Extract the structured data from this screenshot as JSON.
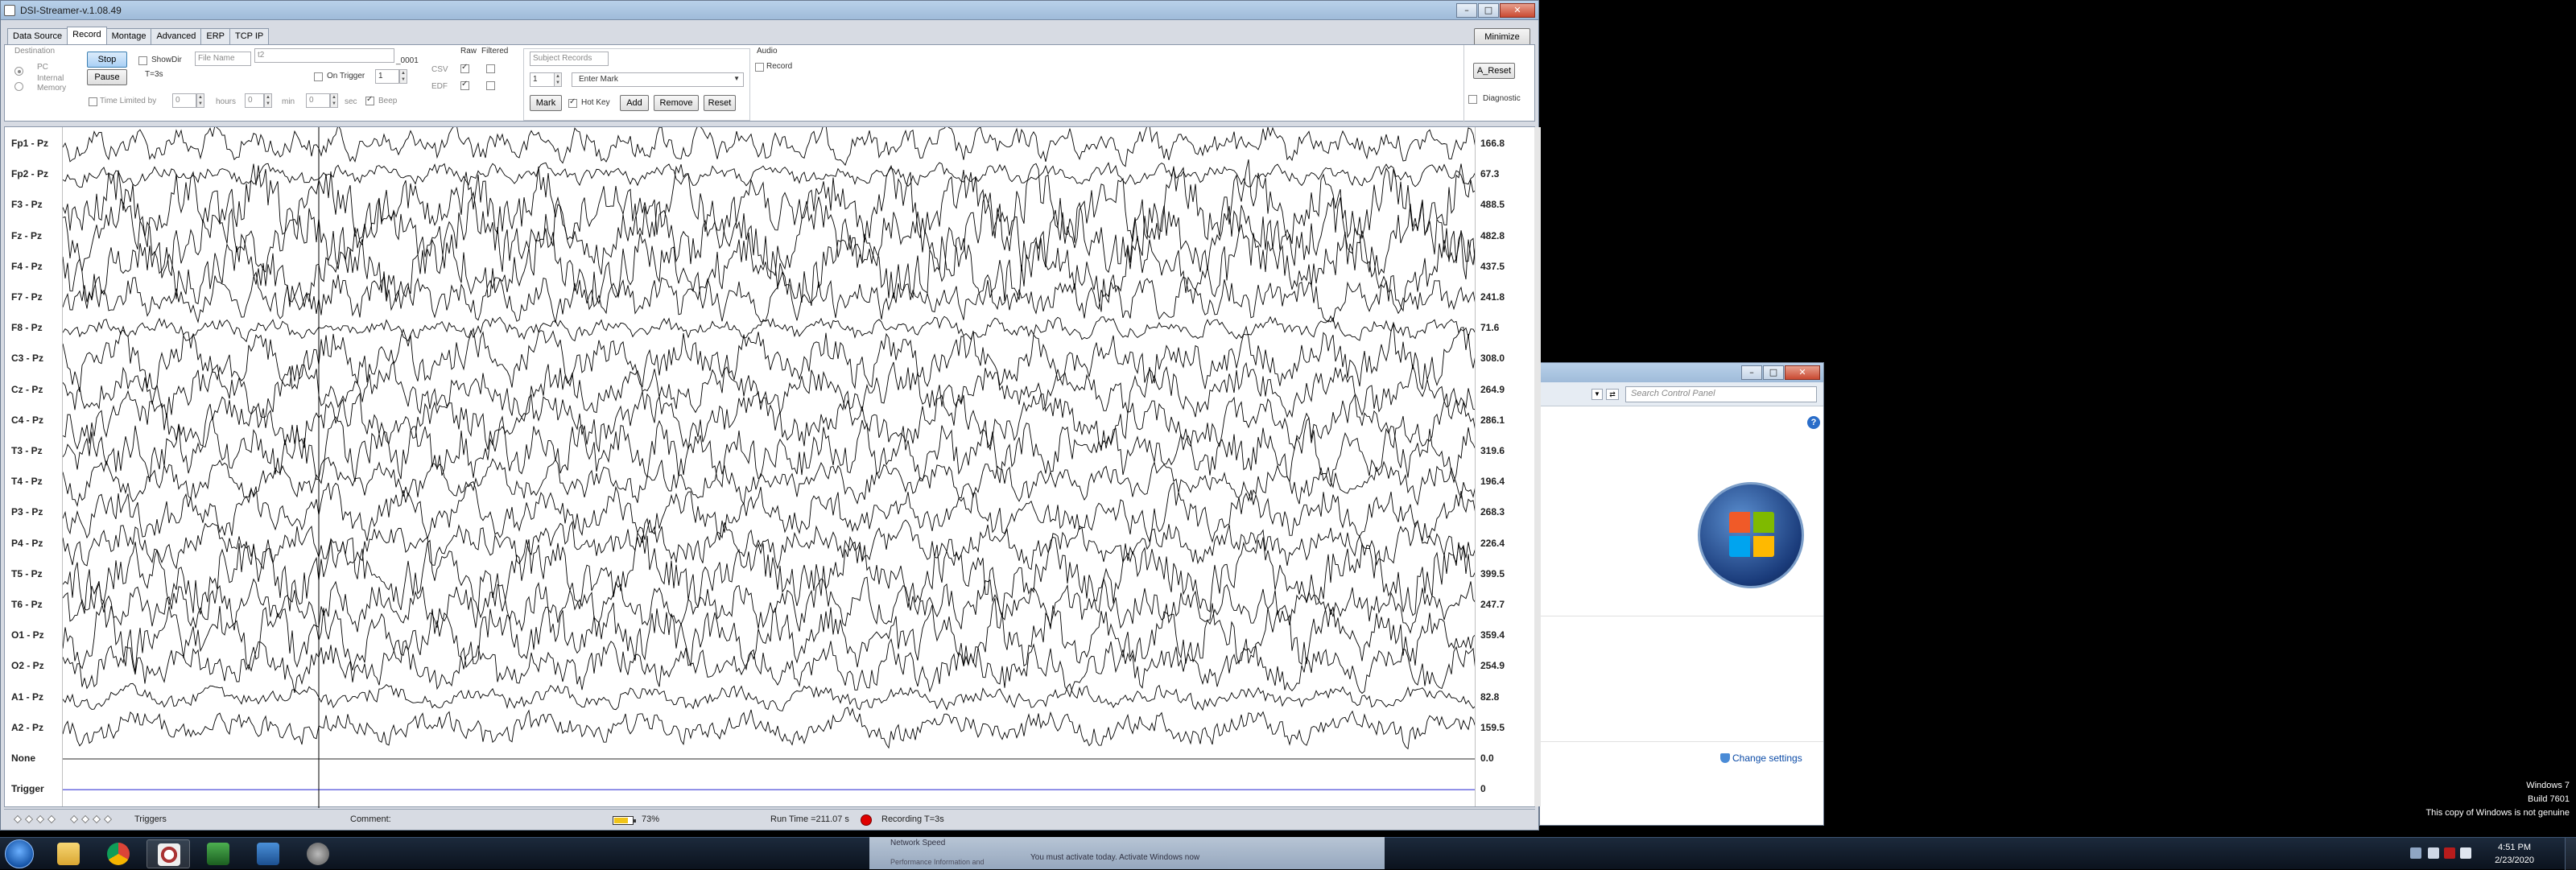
{
  "window": {
    "title": "DSI-Streamer-v.1.08.49",
    "minimize_label": "Minimize"
  },
  "tabs": [
    "Data Source",
    "Record",
    "Montage",
    "Advanced",
    "ERP",
    "TCP IP"
  ],
  "controls": {
    "destination_label": "Destination",
    "destination_pc": "PC",
    "destination_internal_1": "Internal",
    "destination_internal_2": "Memory",
    "stop_label": "Stop",
    "pause_label": "Pause",
    "show_dir_label": "ShowDir",
    "t_value": "T=3s",
    "file_name_label": "File Name",
    "file_name_value": "t2",
    "file_suffix": "_0001",
    "on_trigger_label": "On Trigger",
    "on_trigger_value": "1",
    "raw_label": "Raw",
    "filtered_label": "Filtered",
    "csv_label": "CSV",
    "edf_label": "EDF",
    "time_limited_label": "Time Limited by",
    "hours_value": "0",
    "hours_label": "hours",
    "min_value": "0",
    "min_label": "min",
    "sec_value": "0",
    "sec_label": "sec",
    "beep_label": "Beep",
    "subject_records_label": "Subject Records",
    "mark_index": "1",
    "enter_mark_value": "Enter Mark",
    "mark_label": "Mark",
    "hot_key_label": "Hot Key",
    "add_label": "Add",
    "remove_label": "Remove",
    "reset_label": "Reset",
    "audio_label": "Audio",
    "audio_record_label": "Record",
    "a_reset_label": "A_Reset",
    "diagnostic_label": "Diagnostic"
  },
  "channels": [
    {
      "label": "Fp1 - Pz",
      "scale": "166.8"
    },
    {
      "label": "Fp2 - Pz",
      "scale": "67.3"
    },
    {
      "label": "F3 - Pz",
      "scale": "488.5"
    },
    {
      "label": "Fz - Pz",
      "scale": "482.8"
    },
    {
      "label": "F4 - Pz",
      "scale": "437.5"
    },
    {
      "label": "F7 - Pz",
      "scale": "241.8"
    },
    {
      "label": "F8 - Pz",
      "scale": "71.6"
    },
    {
      "label": "C3 - Pz",
      "scale": "308.0"
    },
    {
      "label": "Cz - Pz",
      "scale": "264.9"
    },
    {
      "label": "C4 - Pz",
      "scale": "286.1"
    },
    {
      "label": "T3 - Pz",
      "scale": "319.6"
    },
    {
      "label": "T4 - Pz",
      "scale": "196.4"
    },
    {
      "label": "P3 - Pz",
      "scale": "268.3"
    },
    {
      "label": "P4 - Pz",
      "scale": "226.4"
    },
    {
      "label": "T5 - Pz",
      "scale": "399.5"
    },
    {
      "label": "T6 - Pz",
      "scale": "247.7"
    },
    {
      "label": "O1 - Pz",
      "scale": "359.4"
    },
    {
      "label": "O2 - Pz",
      "scale": "254.9"
    },
    {
      "label": "A1 - Pz",
      "scale": "82.8"
    },
    {
      "label": "A2 - Pz",
      "scale": "159.5"
    },
    {
      "label": "None",
      "scale": "0.0"
    },
    {
      "label": "Trigger",
      "scale": "0"
    }
  ],
  "status": {
    "triggers_label": "Triggers",
    "comment_label": "Comment:",
    "battery_percent": "73%",
    "run_time": "Run Time =211.07 s",
    "recording_status": "Recording T=3s"
  },
  "control_panel_window": {
    "search_placeholder": "Search Control Panel",
    "help_glyph": "?",
    "change_settings_label": "Change settings"
  },
  "desktop": {
    "watermark_line1": "Windows 7",
    "watermark_line2": "Build 7601",
    "watermark_line3": "This copy of Windows is not genuine"
  },
  "taskbar": {
    "time": "4:51 PM",
    "date": "2/23/2020",
    "notice_title": "Network Speed",
    "notice_text": "You must activate today. Activate Windows now",
    "notice_sub": "Performance Information and"
  },
  "colors": {
    "trace": "#000000",
    "trigger_line": "#3b3bd6",
    "recording_dot": "#e00000",
    "battery": "#f0c419"
  }
}
